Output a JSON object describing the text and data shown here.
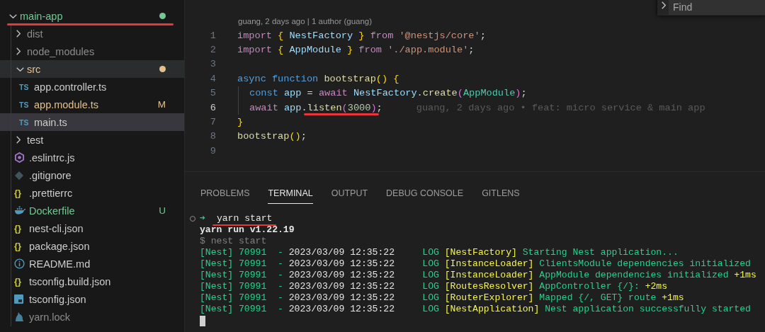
{
  "explorer": {
    "items": [
      {
        "name": "main-app",
        "kind": "folder",
        "expanded": true,
        "selected": false,
        "hovered": false,
        "color": "#73c991",
        "dot": true,
        "underlined": true,
        "children": [
          {
            "name": "dist",
            "kind": "folder",
            "expanded": false,
            "selected": false,
            "hovered": false,
            "color": "#8c8c8c"
          },
          {
            "name": "node_modules",
            "kind": "folder",
            "expanded": false,
            "selected": false,
            "hovered": false,
            "color": "#8c8c8c"
          },
          {
            "name": "src",
            "kind": "folder",
            "expanded": true,
            "selected": false,
            "hovered": true,
            "color": "#e2c08d",
            "dot": true,
            "children": [
              {
                "name": "app.controller.ts",
                "kind": "ts-file",
                "icon": "TS",
                "selected": false,
                "hovered": false,
                "color": "#cccccc"
              },
              {
                "name": "app.module.ts",
                "kind": "ts-file",
                "icon": "TS",
                "badge": "M",
                "selected": false,
                "hovered": false,
                "color": "#e2c08d"
              },
              {
                "name": "main.ts",
                "kind": "ts-file",
                "icon": "TS",
                "selected": true,
                "hovered": false,
                "color": "#cccccc"
              }
            ]
          },
          {
            "name": "test",
            "kind": "folder",
            "expanded": false,
            "selected": false,
            "hovered": false,
            "color": "#cccccc"
          },
          {
            "name": ".eslintrc.js",
            "kind": "eslint-file",
            "selected": false,
            "hovered": false,
            "color": "#cccccc"
          },
          {
            "name": ".gitignore",
            "kind": "git-file",
            "selected": false,
            "hovered": false,
            "color": "#cccccc"
          },
          {
            "name": ".prettierrc",
            "kind": "json-file",
            "icon": "{}",
            "selected": false,
            "hovered": false,
            "color": "#cccccc"
          },
          {
            "name": "Dockerfile",
            "kind": "docker-file",
            "badge": "U",
            "selected": false,
            "hovered": false,
            "color": "#73c991"
          },
          {
            "name": "nest-cli.json",
            "kind": "json-file",
            "icon": "{}",
            "selected": false,
            "hovered": false,
            "color": "#cccccc"
          },
          {
            "name": "package.json",
            "kind": "json-file",
            "icon": "{}",
            "selected": false,
            "hovered": false,
            "color": "#cccccc"
          },
          {
            "name": "README.md",
            "kind": "info-file",
            "selected": false,
            "hovered": false,
            "color": "#cccccc"
          },
          {
            "name": "tsconfig.build.json",
            "kind": "json-file",
            "icon": "{}",
            "selected": false,
            "hovered": false,
            "color": "#cccccc"
          },
          {
            "name": "tsconfig.json",
            "kind": "tsconfig-file",
            "selected": false,
            "hovered": false,
            "color": "#cccccc"
          },
          {
            "name": "yarn.lock",
            "kind": "yarn-file",
            "selected": false,
            "hovered": false,
            "color": "#8c8c8c"
          }
        ]
      }
    ]
  },
  "find_widget": {
    "placeholder": "Find"
  },
  "editor": {
    "blame_header": "guang, 2 days ago | 1 author (guang)",
    "lines": [
      {
        "number": "1",
        "current": false,
        "tokens": [
          {
            "kind": "keyword",
            "text": "import "
          },
          {
            "kind": "bracket",
            "text": "{ "
          },
          {
            "kind": "variable",
            "text": "NestFactory"
          },
          {
            "kind": "bracket",
            "text": " }"
          },
          {
            "kind": "keyword",
            "text": " from "
          },
          {
            "kind": "string",
            "text": "'@nestjs/core'"
          },
          {
            "kind": "plain",
            "text": ";"
          }
        ]
      },
      {
        "number": "2",
        "current": false,
        "tokens": [
          {
            "kind": "keyword",
            "text": "import "
          },
          {
            "kind": "bracket",
            "text": "{ "
          },
          {
            "kind": "variable",
            "text": "AppModule"
          },
          {
            "kind": "bracket",
            "text": " }"
          },
          {
            "kind": "keyword",
            "text": " from "
          },
          {
            "kind": "string",
            "text": "'./app.module'"
          },
          {
            "kind": "plain",
            "text": ";"
          }
        ]
      },
      {
        "number": "3",
        "current": false
      },
      {
        "number": "4",
        "current": false,
        "tokens": [
          {
            "kind": "storage",
            "text": "async function "
          },
          {
            "kind": "function",
            "text": "bootstrap"
          },
          {
            "kind": "bracket",
            "text": "() {"
          }
        ]
      },
      {
        "number": "5",
        "current": false,
        "indent_guide": true,
        "tokens": [
          {
            "kind": "storage",
            "text": "const "
          },
          {
            "kind": "variable",
            "text": "app"
          },
          {
            "kind": "plain",
            "text": " = "
          },
          {
            "kind": "keyword",
            "text": "await "
          },
          {
            "kind": "variable",
            "text": "NestFactory"
          },
          {
            "kind": "plain",
            "text": "."
          },
          {
            "kind": "function",
            "text": "create"
          },
          {
            "kind": "paren",
            "text": "("
          },
          {
            "kind": "type",
            "text": "AppModule"
          },
          {
            "kind": "paren",
            "text": ")"
          },
          {
            "kind": "plain",
            "text": ";"
          }
        ]
      },
      {
        "number": "6",
        "current": true,
        "indent_guide": true,
        "blame": "guang, 2 days ago • feat: micro service & main app",
        "tokens": [
          {
            "kind": "keyword",
            "text": "await "
          },
          {
            "kind": "variable",
            "text": "app"
          },
          {
            "kind": "plain",
            "text": "."
          },
          {
            "kind": "function",
            "text": "listen",
            "underlined": true
          },
          {
            "kind": "paren",
            "text": "(",
            "underlined": true
          },
          {
            "kind": "number",
            "text": "3000",
            "underlined": true
          },
          {
            "kind": "paren",
            "text": ")",
            "underlined": true
          },
          {
            "kind": "plain",
            "text": ";"
          }
        ]
      },
      {
        "number": "7",
        "current": false,
        "tokens": [
          {
            "kind": "bracket",
            "text": "}"
          }
        ]
      },
      {
        "number": "8",
        "current": false,
        "tokens": [
          {
            "kind": "function",
            "text": "bootstrap"
          },
          {
            "kind": "bracket",
            "text": "()"
          },
          {
            "kind": "plain",
            "text": ";"
          }
        ]
      },
      {
        "number": "9",
        "current": false
      }
    ]
  },
  "panel": {
    "tabs": [
      {
        "label": "PROBLEMS",
        "selected": false
      },
      {
        "label": "TERMINAL",
        "selected": true
      },
      {
        "label": "OUTPUT",
        "selected": false
      },
      {
        "label": "DEBUG CONSOLE",
        "selected": false
      },
      {
        "label": "GITLENS",
        "selected": false
      }
    ],
    "terminal": {
      "prompt": {
        "arrow": "➜",
        "command": "yarn start",
        "underlined": true
      },
      "lines": [
        [
          {
            "kind": "bold",
            "text": "yarn run v1.22.19"
          }
        ],
        [
          {
            "kind": "dim",
            "text": "$ nest start"
          }
        ],
        [
          {
            "kind": "green",
            "text": "[Nest] 70991  - "
          },
          {
            "kind": "white",
            "text": "2023/03/09 12:35:22"
          },
          {
            "kind": "green",
            "text": "     LOG "
          },
          {
            "kind": "yellow",
            "text": "[NestFactory]"
          },
          {
            "kind": "green",
            "text": " Starting Nest application..."
          }
        ],
        [
          {
            "kind": "green",
            "text": "[Nest] 70991  - "
          },
          {
            "kind": "white",
            "text": "2023/03/09 12:35:22"
          },
          {
            "kind": "green",
            "text": "     LOG "
          },
          {
            "kind": "yellow",
            "text": "[InstanceLoader]"
          },
          {
            "kind": "green",
            "text": " ClientsModule dependencies initialized"
          }
        ],
        [
          {
            "kind": "green",
            "text": "[Nest] 70991  - "
          },
          {
            "kind": "white",
            "text": "2023/03/09 12:35:22"
          },
          {
            "kind": "green",
            "text": "     LOG "
          },
          {
            "kind": "yellow",
            "text": "[InstanceLoader]"
          },
          {
            "kind": "green",
            "text": " AppModule dependencies initialized "
          },
          {
            "kind": "yellow",
            "text": "+1ms"
          }
        ],
        [
          {
            "kind": "green",
            "text": "[Nest] 70991  - "
          },
          {
            "kind": "white",
            "text": "2023/03/09 12:35:22"
          },
          {
            "kind": "green",
            "text": "     LOG "
          },
          {
            "kind": "yellow",
            "text": "[RoutesResolver]"
          },
          {
            "kind": "green",
            "text": " AppController {/}: "
          },
          {
            "kind": "yellow",
            "text": "+2ms"
          }
        ],
        [
          {
            "kind": "green",
            "text": "[Nest] 70991  - "
          },
          {
            "kind": "white",
            "text": "2023/03/09 12:35:22"
          },
          {
            "kind": "green",
            "text": "     LOG "
          },
          {
            "kind": "yellow",
            "text": "[RouterExplorer]"
          },
          {
            "kind": "green",
            "text": " Mapped {/, GET} route "
          },
          {
            "kind": "yellow",
            "text": "+1ms"
          }
        ],
        [
          {
            "kind": "green",
            "text": "[Nest] 70991  - "
          },
          {
            "kind": "white",
            "text": "2023/03/09 12:35:22"
          },
          {
            "kind": "green",
            "text": "     LOG "
          },
          {
            "kind": "yellow",
            "text": "[NestApplication]"
          },
          {
            "kind": "green",
            "text": " Nest application successfully started"
          }
        ]
      ]
    }
  }
}
